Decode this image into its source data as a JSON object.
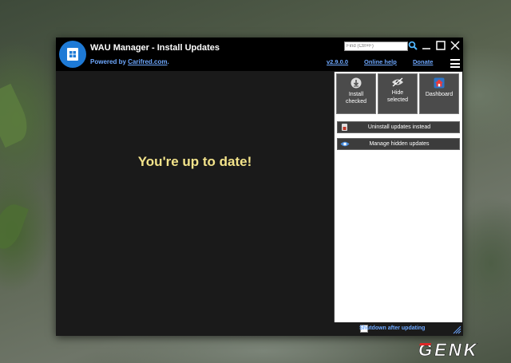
{
  "window": {
    "title": "WAU Manager - Install Updates",
    "powered_prefix": "Powered by",
    "powered_link": "Carifred.com",
    "powered_suffix": "."
  },
  "search": {
    "placeholder": "Find (Ctrl+F)"
  },
  "links": {
    "version": "v2.9.0.0",
    "help": "Online help",
    "donate": "Donate"
  },
  "main": {
    "status": "You're up to date!"
  },
  "actions": [
    {
      "label1": "Install",
      "label2": "checked",
      "icon": "download-icon"
    },
    {
      "label1": "Hide",
      "label2": "selected",
      "icon": "eye-hide-icon"
    },
    {
      "label1": "Dashboard",
      "label2": "",
      "icon": "home-icon"
    }
  ],
  "side_buttons": {
    "uninstall": "Uninstall updates instead",
    "hidden": "Manage hidden updates"
  },
  "footer": {
    "shutdown": "Shutdown after updating"
  },
  "watermark": {
    "text": "GENK"
  },
  "colors": {
    "accent_link": "#6ea8ff",
    "status_text": "#f3e38a",
    "logo_blue": "#1e7ad6"
  }
}
